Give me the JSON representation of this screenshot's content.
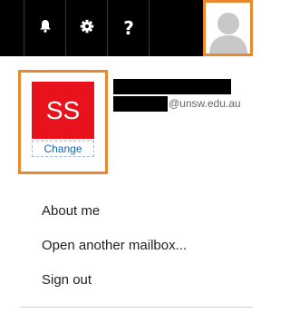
{
  "topbar": {
    "icons": {
      "notifications": "bell-icon",
      "settings": "gear-icon",
      "help": "question-icon"
    },
    "help_glyph": "?",
    "avatar_icon": "user-avatar-icon",
    "accent_color": "#e78a2f"
  },
  "profile": {
    "initials": "SS",
    "initials_bg": "#e8121c",
    "change_label": "Change",
    "email_domain": "@unsw.edu.au"
  },
  "menu": {
    "items": [
      {
        "label": "About me"
      },
      {
        "label": "Open another mailbox..."
      },
      {
        "label": "Sign out"
      }
    ]
  }
}
